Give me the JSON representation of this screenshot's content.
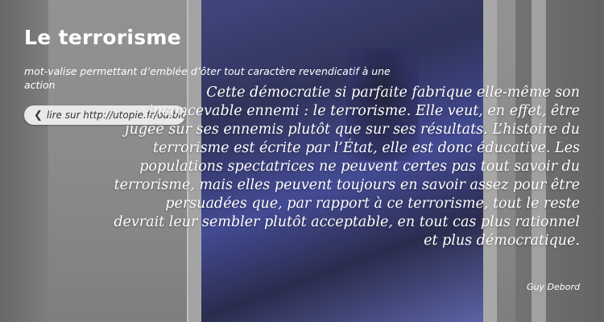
{
  "page": {
    "title": "Le terrorisme",
    "subtitle": "mot-valise permettant d’emblée d’ôter tout caractère revendicatif à une action",
    "read_link": {
      "label": "lire sur http://utopie.fr/ou.blogspot.fr",
      "icon": "chevron-left-icon"
    },
    "quote": "Cette démocratie si parfaite fabrique elle-même son inconcevable ennemi : le terrorisme. Elle veut, en effet, être jugée sur ses ennemis plutôt que sur ses résultats. L’histoire du terrorisme est écrite par l’État, elle est donc éducative. Les populations spectatrices ne peuvent certes pas tout savoir du terrorisme, mais elles peuvent toujours en savoir assez pour être persuadées que, par rapport à ce terrorisme, tout le reste devrait leur sembler plutôt acceptable, en tout cas plus rationnel et plus démocratique.",
    "author": "Guy Debord"
  },
  "colors": {
    "text": "#ffffff",
    "link_pill": "#e9e9e9",
    "screen_blue": "#3c46a4"
  }
}
